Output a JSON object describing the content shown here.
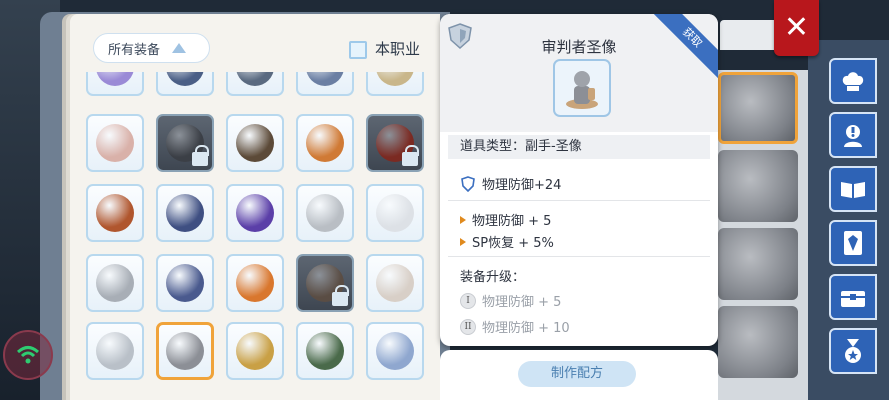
{
  "filter": {
    "label": "所有装备",
    "checkbox_label": "本职业"
  },
  "item_card": {
    "title": "审判者圣像",
    "ribbon": "获取",
    "type_label": "道具类型：副手-圣像",
    "base_stat": "物理防御+24",
    "bonuses": [
      "物理防御 + 5",
      "SP恢复 + 5%"
    ],
    "upgrade_heading": "装备升级：",
    "upgrades": [
      {
        "tier": "I",
        "text": "物理防御 + 5"
      },
      {
        "tier": "II",
        "text": "物理防御 + 10"
      }
    ]
  },
  "recipe": {
    "button": "制作配方"
  },
  "close": {
    "label": "✕"
  },
  "sidebar_icons": [
    "chef-hat-icon",
    "person-alert-icon",
    "book-icon",
    "card-icon",
    "chest-icon",
    "medal-icon"
  ],
  "grid_items": [
    {
      "name": "staff",
      "color": "#9a8ad6",
      "locked": false,
      "dark": false
    },
    {
      "name": "scythe",
      "color": "#4b5f86",
      "locked": false,
      "dark": false
    },
    {
      "name": "axe",
      "color": "#5a6a80",
      "locked": false,
      "dark": false
    },
    {
      "name": "sword",
      "color": "#6b7fa3",
      "locked": false,
      "dark": false
    },
    {
      "name": "horn",
      "color": "#c9b68a",
      "locked": false,
      "dark": false
    },
    {
      "name": "round-shield",
      "color": "#d9b1a9",
      "locked": false,
      "dark": false
    },
    {
      "name": "tower-shield",
      "color": "#3b3f46",
      "locked": true,
      "dark": true
    },
    {
      "name": "buckler",
      "color": "#5c4a38",
      "locked": false,
      "dark": false
    },
    {
      "name": "crest-shield",
      "color": "#d07a35",
      "locked": false,
      "dark": false
    },
    {
      "name": "grimoire",
      "color": "#7b2a22",
      "locked": true,
      "dark": true
    },
    {
      "name": "spellbook",
      "color": "#b0562e",
      "locked": false,
      "dark": false
    },
    {
      "name": "tome",
      "color": "#3f4f82",
      "locked": false,
      "dark": false
    },
    {
      "name": "dark-shield",
      "color": "#5b3fa8",
      "locked": false,
      "dark": false
    },
    {
      "name": "steel-shield",
      "color": "#b9bec4",
      "locked": false,
      "dark": false
    },
    {
      "name": "mirror",
      "color": "#dde1e6",
      "locked": false,
      "dark": false
    },
    {
      "name": "kite-shield",
      "color": "#a8aeb6",
      "locked": false,
      "dark": false
    },
    {
      "name": "blue-book",
      "color": "#4a5a8e",
      "locked": false,
      "dark": false
    },
    {
      "name": "flame-shield",
      "color": "#d9772e",
      "locked": false,
      "dark": false
    },
    {
      "name": "iron-shield",
      "color": "#5a4d44",
      "locked": true,
      "dark": true
    },
    {
      "name": "angel-statue",
      "color": "#d8cfc7",
      "locked": false,
      "dark": false
    },
    {
      "name": "dragon-statue",
      "color": "#b9c0c8",
      "locked": false,
      "dark": false
    },
    {
      "name": "judge-statue",
      "color": "#8c8f96",
      "locked": false,
      "dark": false,
      "selected": true
    },
    {
      "name": "golden-idol",
      "color": "#c9a045",
      "locked": false,
      "dark": false
    },
    {
      "name": "gauntlet",
      "color": "#4a6a4a",
      "locked": false,
      "dark": false
    },
    {
      "name": "crystal-fist",
      "color": "#8fa7cf",
      "locked": false,
      "dark": false
    }
  ]
}
